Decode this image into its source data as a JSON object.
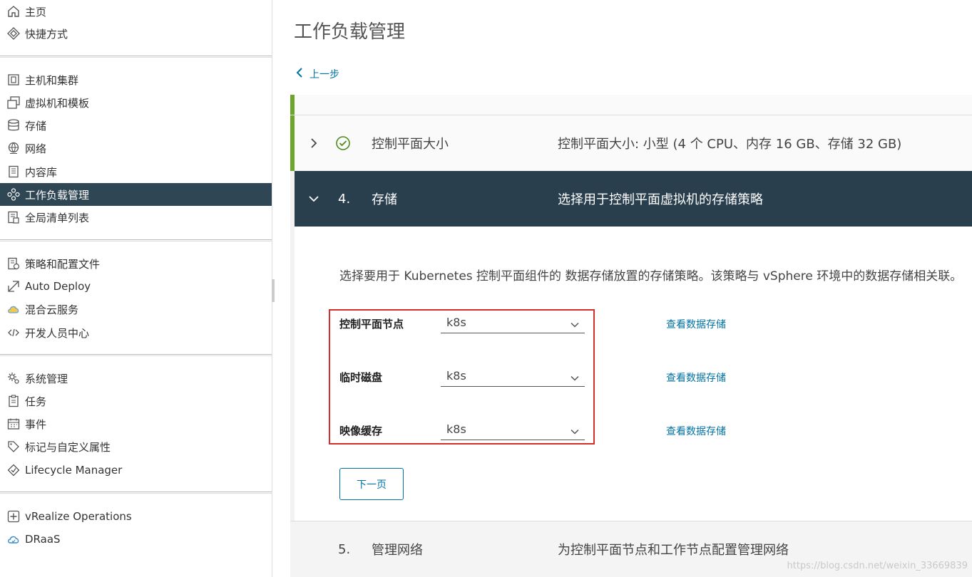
{
  "sidebar": {
    "items": [
      {
        "label": "主页",
        "icon": "home-icon"
      },
      {
        "label": "快捷方式",
        "icon": "shortcuts-icon"
      },
      {
        "label": "主机和集群",
        "icon": "hosts-clusters-icon"
      },
      {
        "label": "虚拟机和模板",
        "icon": "vms-templates-icon"
      },
      {
        "label": "存储",
        "icon": "storage-icon"
      },
      {
        "label": "网络",
        "icon": "network-icon"
      },
      {
        "label": "内容库",
        "icon": "content-library-icon"
      },
      {
        "label": "工作负载管理",
        "icon": "workload-icon"
      },
      {
        "label": "全局清单列表",
        "icon": "inventory-list-icon"
      },
      {
        "label": "策略和配置文件",
        "icon": "policies-icon"
      },
      {
        "label": "Auto Deploy",
        "icon": "auto-deploy-icon"
      },
      {
        "label": "混合云服务",
        "icon": "hybrid-cloud-icon"
      },
      {
        "label": "开发人员中心",
        "icon": "code-icon"
      },
      {
        "label": "系统管理",
        "icon": "admin-gear-icon"
      },
      {
        "label": "任务",
        "icon": "tasks-icon"
      },
      {
        "label": "事件",
        "icon": "events-icon"
      },
      {
        "label": "标记与自定义属性",
        "icon": "tag-icon"
      },
      {
        "label": "Lifecycle Manager",
        "icon": "lifecycle-icon"
      },
      {
        "label": "vRealize Operations",
        "icon": "vrealize-icon"
      },
      {
        "label": "DRaaS",
        "icon": "draas-cloud-icon"
      }
    ],
    "active_index": 7
  },
  "main": {
    "title": "工作负载管理",
    "back_label": "上一步",
    "steps": {
      "done": {
        "title": "控制平面大小",
        "desc": "控制平面大小: 小型 (4 个 CPU、内存 16 GB、存储 32 GB)"
      },
      "active": {
        "number": "4.",
        "title": "存储",
        "desc": "选择用于控制平面虚拟机的存储策略"
      },
      "next": {
        "number": "5.",
        "title": "管理网络",
        "desc": "为控制平面节点和工作节点配置管理网络"
      }
    },
    "intro": "选择要用于 Kubernetes 控制平面组件的 数据存储放置的存储策略。该策略与 vSphere 环境中的数据存储相关联。",
    "fields": [
      {
        "label": "控制平面节点",
        "value": "k8s",
        "link": "查看数据存储"
      },
      {
        "label": "临时磁盘",
        "value": "k8s",
        "link": "查看数据存储"
      },
      {
        "label": "映像缓存",
        "value": "k8s",
        "link": "查看数据存储"
      }
    ],
    "next_button": "下一页"
  },
  "watermark": "https://blog.csdn.net/weixin_33669839",
  "colors": {
    "active_nav": "#2f4655",
    "active_step": "#2a3f4e",
    "done_bar": "#6ca42c",
    "link": "#0072a3",
    "highlight": "#d32f2f"
  }
}
